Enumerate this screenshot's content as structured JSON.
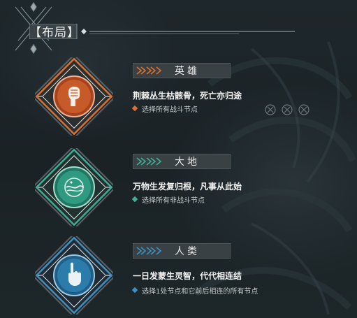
{
  "panel": {
    "title": "【布局】"
  },
  "roles": [
    {
      "name": "英雄",
      "description": "荆棘丛生枯骸骨，死亡亦归途",
      "rule": "选择所有战斗节点",
      "accent": "#d9702f",
      "icon": "raised-fist-icon"
    },
    {
      "name": "大地",
      "description": "万物生发复归根，凡事从此始",
      "rule": "选择所有非战斗节点",
      "accent": "#3fae95",
      "icon": "earth-orb-icon"
    },
    {
      "name": "人类",
      "description": "一日发蒙生灵智，代代相连结",
      "rule": "选择1处节点和它前后相连的所有节点",
      "accent": "#3f8fc0",
      "icon": "pointing-hand-icon"
    }
  ],
  "slots": {
    "count": 3
  }
}
